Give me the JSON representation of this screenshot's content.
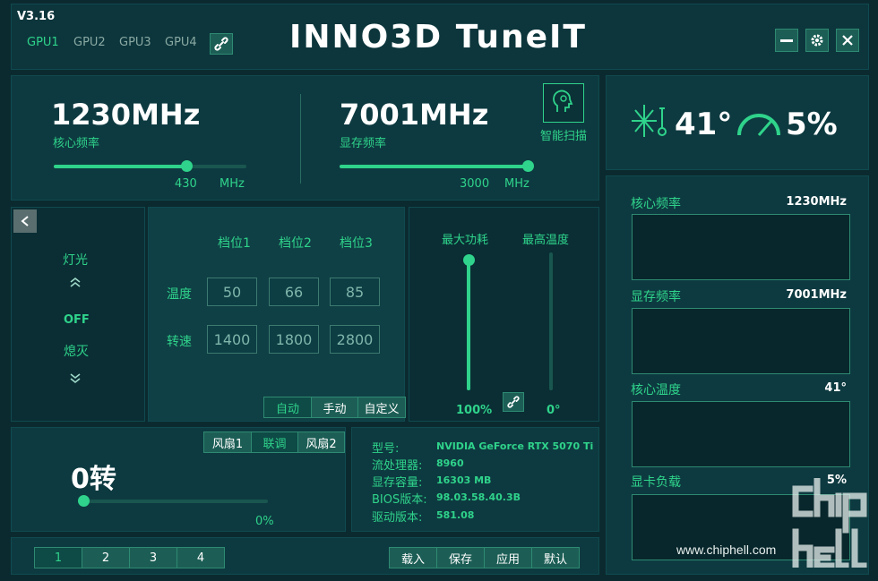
{
  "header": {
    "version": "V3.16",
    "title": "INNO3D TuneIT",
    "gpu_tabs": [
      "GPU1",
      "GPU2",
      "GPU3",
      "GPU4"
    ],
    "colors": {
      "accent": "#2fd38b",
      "background": "#0b2a2f"
    }
  },
  "clocks": {
    "core_value": "1230MHz",
    "core_label": "核心频率",
    "core_offset": "430",
    "core_unit": "MHz",
    "core_slider_level": 0.69,
    "mem_value": "7001MHz",
    "mem_label": "显存频率",
    "mem_offset": "3000",
    "mem_unit": "MHz",
    "mem_slider_level": 0.98,
    "scan_label": "智能扫描"
  },
  "status": {
    "temperature": "41°",
    "load": "5%"
  },
  "lighting": {
    "label": "灯光",
    "state": "OFF",
    "mode": "熄灭"
  },
  "fan_curve": {
    "headers": [
      "档位1",
      "档位2",
      "档位3"
    ],
    "row_temp_label": "温度",
    "row_speed_label": "转速",
    "temps": [
      "50",
      "66",
      "85"
    ],
    "speeds": [
      "1400",
      "1800",
      "2800"
    ],
    "modes": [
      "自动",
      "手动",
      "自定义"
    ],
    "active_mode": "自动"
  },
  "power": {
    "max_power_label": "最大功耗",
    "max_temp_label": "最高温度",
    "max_power_value": "100%",
    "max_temp_value": "0°",
    "max_power_level": 1.0,
    "max_temp_level": 0.0
  },
  "fan": {
    "tabs": [
      "风扇1",
      "联调",
      "风扇2"
    ],
    "active_tab": "联调",
    "speed": "0转",
    "percent": "0%",
    "level": 0.0
  },
  "info": {
    "rows": [
      {
        "label": "型号:",
        "value": "NVIDIA GeForce RTX 5070 Ti"
      },
      {
        "label": "流处理器:",
        "value": "8960"
      },
      {
        "label": "显存容量:",
        "value": "16303 MB"
      },
      {
        "label": "BIOS版本:",
        "value": "98.03.58.40.3B"
      },
      {
        "label": "驱动版本:",
        "value": "581.08"
      }
    ]
  },
  "profiles": {
    "items": [
      "1",
      "2",
      "3",
      "4"
    ],
    "active": "1"
  },
  "actions": {
    "load": "载入",
    "save": "保存",
    "apply": "应用",
    "default": "默认"
  },
  "monitor": {
    "items": [
      {
        "label": "核心频率",
        "value": "1230MHz"
      },
      {
        "label": "显存频率",
        "value": "7001MHz"
      },
      {
        "label": "核心温度",
        "value": "41°"
      },
      {
        "label": "显卡负载",
        "value": "5%"
      }
    ]
  },
  "watermark": {
    "logo": "chip hell",
    "url": "www.chiphell.com"
  }
}
